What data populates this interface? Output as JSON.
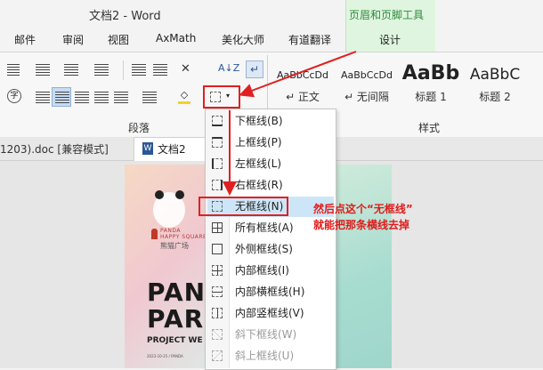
{
  "app": {
    "title": "文档2 - Word",
    "contextual_group": "页眉和页脚工具"
  },
  "tabs": [
    "邮件",
    "审阅",
    "视图",
    "AxMath",
    "美化大师",
    "有道翻译",
    "设计"
  ],
  "ribbon": {
    "group_paragraph": "段落",
    "group_styles": "样式",
    "styles": [
      {
        "preview": "AaBbCcDd",
        "name": "↵ 正文"
      },
      {
        "preview": "AaBbCcDd",
        "name": "↵ 无间隔"
      },
      {
        "preview": "AaBb",
        "name": "标题 1"
      },
      {
        "preview": "AaBbC",
        "name": "标题 2"
      }
    ],
    "sort_label": "A↓Z"
  },
  "doc_tabs": {
    "first": "1203).doc [兼容模式]",
    "second": "文档2",
    "second_icon": "W"
  },
  "menu": {
    "items": [
      {
        "label": "下框线(B)",
        "disabled": false
      },
      {
        "label": "上框线(P)",
        "disabled": false
      },
      {
        "label": "左框线(L)",
        "disabled": false
      },
      {
        "label": "右框线(R)",
        "disabled": false
      },
      {
        "label": "无框线(N)",
        "disabled": false,
        "selected": true
      },
      {
        "label": "所有框线(A)",
        "disabled": false
      },
      {
        "label": "外侧框线(S)",
        "disabled": false
      },
      {
        "label": "内部框线(I)",
        "disabled": false
      },
      {
        "label": "内部横框线(H)",
        "disabled": false
      },
      {
        "label": "内部竖框线(V)",
        "disabled": false
      },
      {
        "label": "斜下框线(W)",
        "disabled": true
      },
      {
        "label": "斜上框线(U)",
        "disabled": true
      }
    ]
  },
  "poster": {
    "brand_line1": "PANDA",
    "brand_line2": "HAPPY SQUARE",
    "brand_cn": "熊猫广场",
    "title_line1": "PAN",
    "title_line2": "PAR",
    "subtitle": "PROJECT WE",
    "footer": "2023-10-25 / PANDA"
  },
  "annotation": {
    "line1": "然后点这个“无框线”",
    "line2": "就能把那条横线去掉"
  },
  "colors": {
    "accent_red": "#e02020",
    "context_green": "#2d8a3d",
    "selected_bg": "#cde6f7"
  }
}
